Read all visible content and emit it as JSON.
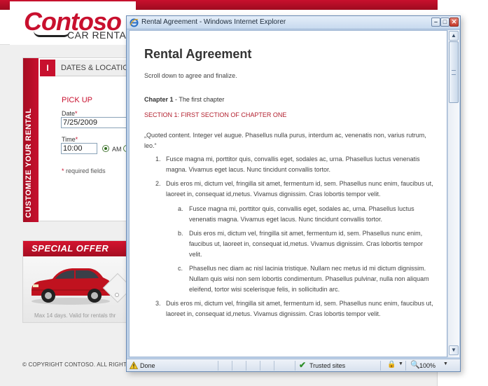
{
  "site": {
    "logo_word": "Contoso",
    "logo_sub": "CAR RENTAL",
    "sidebar_vertical": "CUSTOMIZE YOUR RENTAL",
    "step_number": "I",
    "step_title": "DATES & LOCATIONS",
    "pickup_title": "PICK UP",
    "date_label": "Date",
    "date_value": "7/25/2009",
    "time_label": "Time",
    "time_value": "10:00",
    "am_label": "AM",
    "required_star": "*",
    "required_note": "required fields",
    "offer_title": "SPECIAL OFFER",
    "offer_small": "Max 14 days. Valid for rentals thr",
    "copyright": "© COPYRIGHT CONTOSO. ALL RIGHT",
    "brand_color": "#c8102e"
  },
  "ie_window": {
    "title": "Rental Agreement - Windows Internet Explorer",
    "minimize_glyph": "–",
    "maximize_glyph": "□",
    "close_glyph": "✕",
    "scroll_up_glyph": "▲",
    "scroll_down_glyph": "▼"
  },
  "document": {
    "heading": "Rental Agreement",
    "intro": "Scroll down to agree and finalize.",
    "chapter_label": "Chapter 1",
    "chapter_rest": " - The first chapter",
    "section": "SECTION 1: FIRST SECTION OF CHAPTER ONE",
    "quote": "„Quoted content. Integer vel augue. Phasellus nulla purus, interdum ac, venenatis non, varius rutrum, leo.“",
    "items": [
      {
        "marker": "1.",
        "text": "Fusce magna mi, porttitor quis, convallis eget, sodales ac, urna. Phasellus luctus venenatis magna. Vivamus eget lacus. Nunc tincidunt convallis tortor."
      },
      {
        "marker": "2.",
        "text": "Duis eros mi, dictum vel, fringilla sit amet, fermentum id, sem. Phasellus nunc enim, faucibus ut, laoreet in, consequat id,metus. Vivamus dignissim. Cras lobortis tempor velit."
      },
      {
        "marker": "3.",
        "text": "Duis eros mi, dictum vel, fringilla sit amet, fermentum id, sem. Phasellus nunc enim, faucibus ut, laoreet in, consequat id,metus. Vivamus dignissim. Cras lobortis tempor velit."
      }
    ],
    "subitems": [
      {
        "marker": "a.",
        "text": "Fusce magna mi, porttitor quis, convallis eget, sodales ac, urna. Phasellus luctus venenatis magna. Vivamus eget lacus. Nunc tincidunt convallis tortor."
      },
      {
        "marker": "b.",
        "text": "Duis eros mi, dictum vel, fringilla sit amet, fermentum id, sem. Phasellus nunc enim, faucibus ut, laoreet in, consequat id,metus. Vivamus dignissim. Cras lobortis tempor velit."
      },
      {
        "marker": "c.",
        "text": "Phasellus nec diam ac nisl lacinia tristique. Nullam nec metus id mi dictum dignissim. Nullam quis wisi non sem lobortis condimentum. Phasellus pulvinar, nulla non aliquam eleifend, tortor wisi scelerisque felis, in sollicitudin arc."
      }
    ]
  },
  "status_bar": {
    "done": "Done",
    "trusted": "Trusted sites",
    "zoom": "100%",
    "dropdown_glyph": "▼",
    "icons": [
      "warning-icon",
      "check-icon",
      "lock-icon",
      "zoom-icon"
    ]
  }
}
